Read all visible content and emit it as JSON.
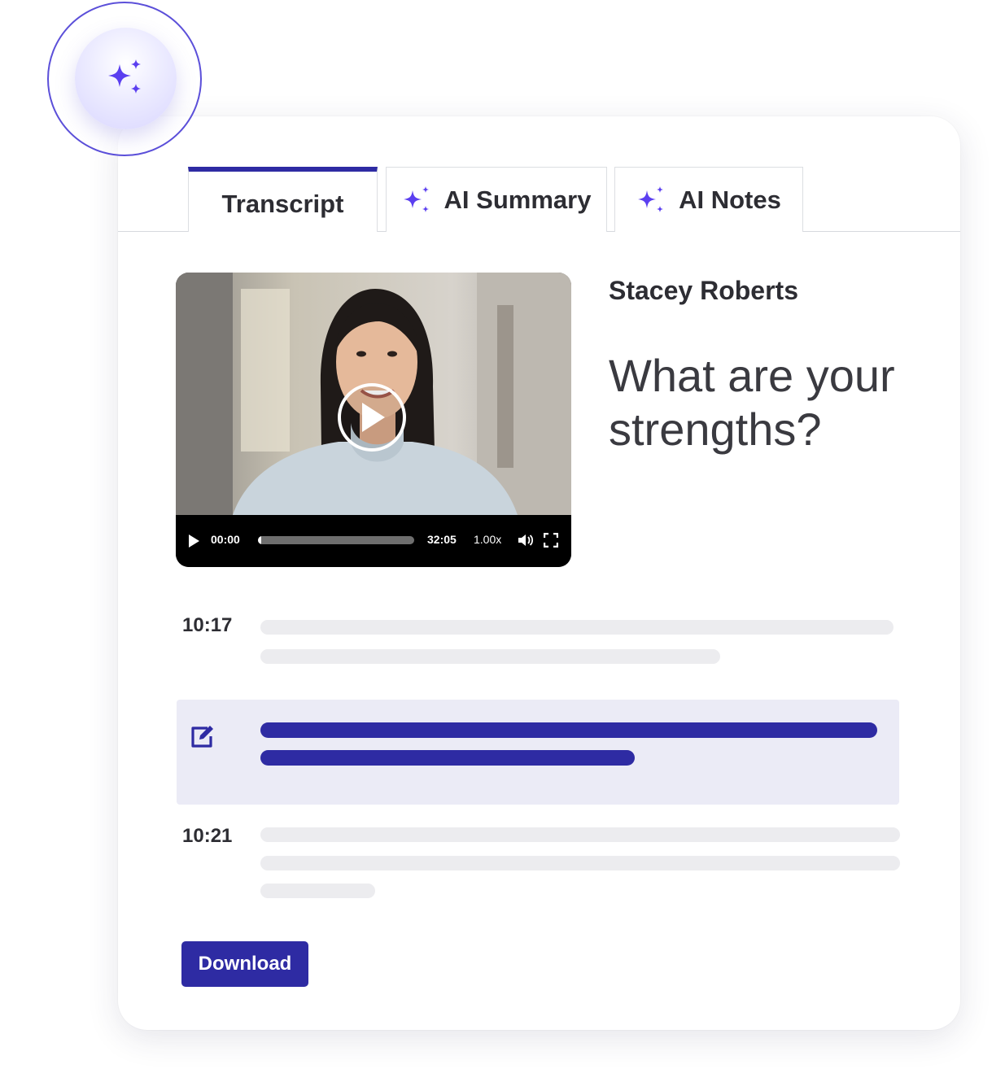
{
  "tabs": [
    {
      "label": "Transcript",
      "active": true
    },
    {
      "label": "AI Summary",
      "icon": "sparkles-icon"
    },
    {
      "label": "AI Notes",
      "icon": "sparkles-icon"
    }
  ],
  "badge": {
    "icon": "sparkles-icon"
  },
  "video": {
    "current_time": "00:00",
    "duration": "32:05",
    "speed": "1.00x",
    "progress": 0.02
  },
  "candidate": {
    "name": "Stacey Roberts",
    "question": "What are your strengths?"
  },
  "transcript": [
    {
      "timestamp": "10:17"
    },
    {
      "highlighted": true,
      "icon": "edit-icon"
    },
    {
      "timestamp": "10:21"
    }
  ],
  "actions": {
    "download_label": "Download"
  },
  "colors": {
    "accent": "#2e2ba3",
    "sparkle": "#5b3ff0",
    "highlight_bg": "#ebebf6",
    "placeholder_bar": "#ececef"
  }
}
